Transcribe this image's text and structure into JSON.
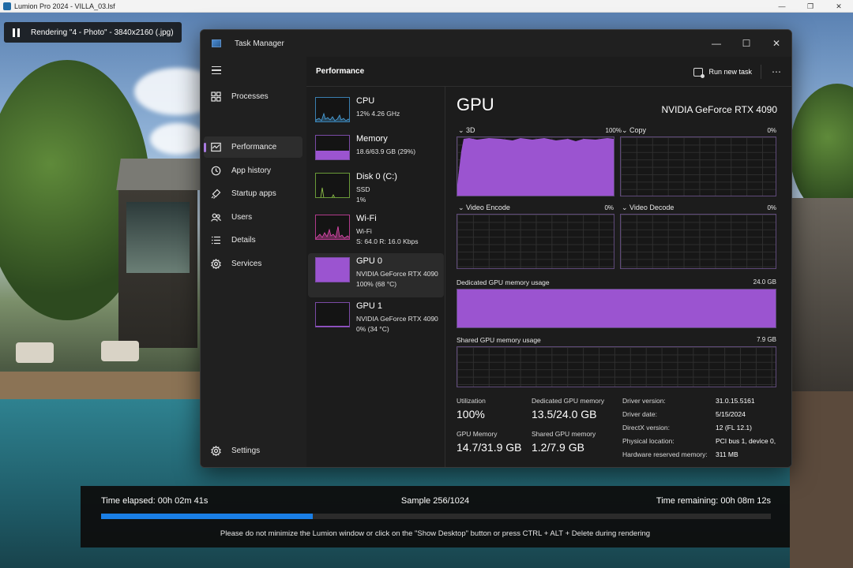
{
  "lumion": {
    "window_title": "Lumion Pro 2024 - VILLA_03.lsf",
    "render_status": "Rendering \"4 - Photo\" - 3840x2160 (.jpg)",
    "progress": {
      "elapsed": "Time elapsed: 00h 02m 41s",
      "sample": "Sample 256/1024",
      "remaining": "Time remaining: 00h 08m 12s",
      "fraction": 0.316,
      "warning": "Please do not minimize the Lumion window or click on the \"Show Desktop\" button or press CTRL + ALT + Delete during rendering"
    }
  },
  "task_manager": {
    "title": "Task Manager",
    "nav": [
      {
        "label": "Processes",
        "icon": "processes-icon"
      },
      {
        "label": "Performance",
        "icon": "performance-icon",
        "active": true
      },
      {
        "label": "App history",
        "icon": "app-history-icon"
      },
      {
        "label": "Startup apps",
        "icon": "startup-apps-icon"
      },
      {
        "label": "Users",
        "icon": "users-icon"
      },
      {
        "label": "Details",
        "icon": "details-icon"
      },
      {
        "label": "Services",
        "icon": "services-icon"
      }
    ],
    "settings_label": "Settings",
    "page_title": "Performance",
    "run_new_task": "Run new task",
    "more": "⋯",
    "devices": [
      {
        "name": "CPU",
        "line2": "12%  4.26 GHz",
        "line3": "",
        "color": "#4aa3df"
      },
      {
        "name": "Memory",
        "line2": "18.6/63.9 GB (29%)",
        "line3": "",
        "color": "#9b54d0"
      },
      {
        "name": "Disk 0 (C:)",
        "line2": "SSD",
        "line3": "1%",
        "color": "#8fc04a"
      },
      {
        "name": "Wi-Fi",
        "line2": "Wi-Fi",
        "line3": "S: 64.0  R: 16.0 Kbps",
        "color": "#e04ab0"
      },
      {
        "name": "GPU 0",
        "line2": "NVIDIA GeForce RTX 4090",
        "line3": "100%  (68 °C)",
        "color": "#9b54d0",
        "active": true
      },
      {
        "name": "GPU 1",
        "line2": "NVIDIA GeForce RTX 4090",
        "line3": "0%  (34 °C)",
        "color": "#9b54d0"
      }
    ],
    "gpu": {
      "heading": "GPU",
      "model": "NVIDIA GeForce RTX 4090",
      "engines": [
        {
          "label": "3D",
          "pct": "100%"
        },
        {
          "label": "Copy",
          "pct": "0%"
        },
        {
          "label": "Video Encode",
          "pct": "0%"
        },
        {
          "label": "Video Decode",
          "pct": "0%"
        }
      ],
      "dedicated_label": "Dedicated GPU memory usage",
      "dedicated_max": "24.0 GB",
      "shared_label": "Shared GPU memory usage",
      "shared_max": "7.9 GB",
      "stats": {
        "utilization_label": "Utilization",
        "utilization": "100%",
        "dedicated_label": "Dedicated GPU memory",
        "dedicated": "13.5/24.0 GB",
        "gpu_memory_label": "GPU Memory",
        "gpu_memory": "14.7/31.9 GB",
        "shared_label": "Shared GPU memory",
        "shared": "1.2/7.9 GB"
      },
      "info": [
        {
          "label": "Driver version:",
          "value": "31.0.15.5161"
        },
        {
          "label": "Driver date:",
          "value": "5/15/2024"
        },
        {
          "label": "DirectX version:",
          "value": "12 (FL 12.1)"
        },
        {
          "label": "Physical location:",
          "value": "PCI bus 1, device 0,"
        },
        {
          "label": "Hardware reserved memory:",
          "value": "311 MB"
        }
      ]
    }
  }
}
